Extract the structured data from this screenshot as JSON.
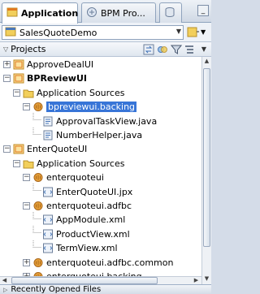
{
  "tabs": [
    {
      "label": "Application",
      "active": true
    },
    {
      "label": "BPM Pro...",
      "active": false
    }
  ],
  "application_selector": {
    "value": "SalesQuoteDemo"
  },
  "projects_panel": {
    "title": "Projects"
  },
  "tree": {
    "items": [
      {
        "label": "ApproveDealUI",
        "type": "project",
        "expanded": false,
        "bold": false
      },
      {
        "label": "BPReviewUI",
        "type": "project",
        "expanded": true,
        "bold": true
      },
      {
        "label": "Application Sources",
        "type": "folder",
        "expanded": true
      },
      {
        "label": "bpreviewui.backing",
        "type": "package",
        "expanded": true,
        "selected": true
      },
      {
        "label": "ApprovalTaskView.java",
        "type": "java"
      },
      {
        "label": "NumberHelper.java",
        "type": "java"
      },
      {
        "label": "EnterQuoteUI",
        "type": "project",
        "expanded": true
      },
      {
        "label": "Application Sources",
        "type": "folder",
        "expanded": true
      },
      {
        "label": "enterquoteui",
        "type": "package",
        "expanded": true
      },
      {
        "label": "EnterQuoteUI.jpx",
        "type": "xml"
      },
      {
        "label": "enterquoteui.adfbc",
        "type": "package",
        "expanded": true
      },
      {
        "label": "AppModule.xml",
        "type": "xml"
      },
      {
        "label": "ProductView.xml",
        "type": "xml"
      },
      {
        "label": "TermView.xml",
        "type": "xml"
      },
      {
        "label": "enterquoteui.adfbc.common",
        "type": "package",
        "expanded": false
      },
      {
        "label": "enterquoteui.backing",
        "type": "package",
        "expanded": false
      }
    ]
  },
  "recent_panel": {
    "title": "Recently Opened Files"
  },
  "colors": {
    "selection": "#3875d7",
    "folder": "#f2cf5b",
    "project_icon": "#e07a1f"
  }
}
